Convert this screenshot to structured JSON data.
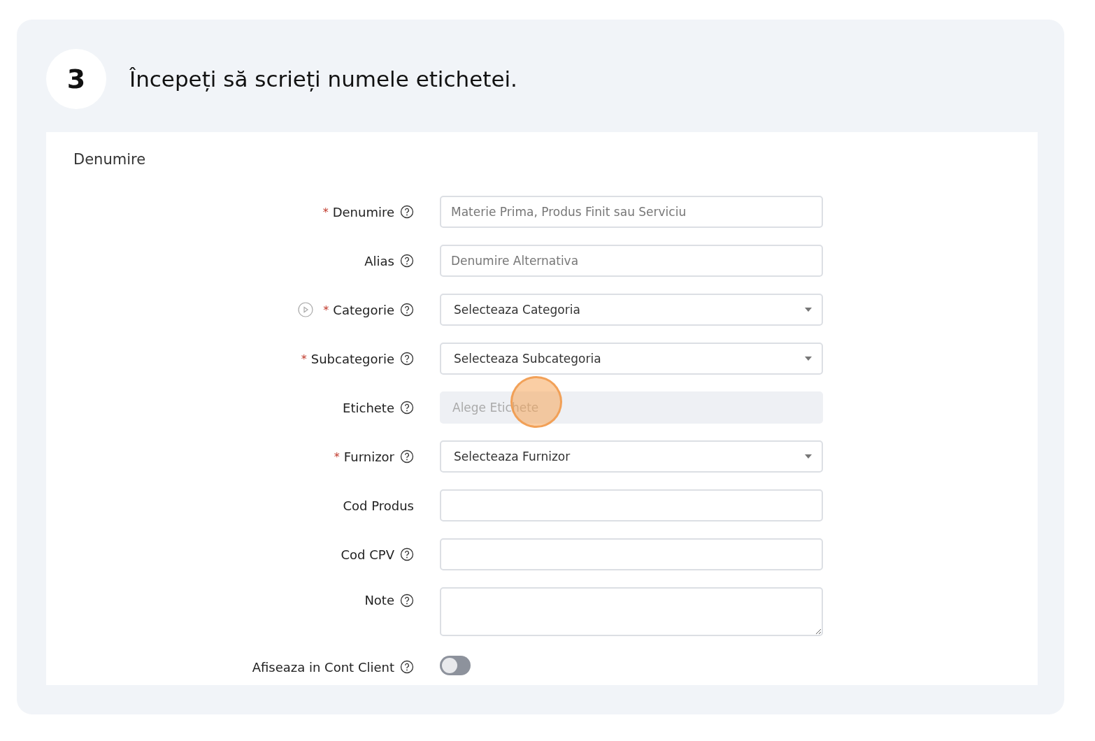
{
  "step": {
    "number": "3",
    "instruction": "Începeți să scrieți numele etichetei."
  },
  "section": {
    "title": "Denumire"
  },
  "fields": [
    {
      "kind": "text",
      "label": "Denumire",
      "required_mark": "*",
      "help": true,
      "placeholder": "Materie Prima, Produs Finit sau Serviciu"
    },
    {
      "kind": "text",
      "label": "Alias",
      "help": true,
      "placeholder": "Denumire Alternativa"
    },
    {
      "kind": "select",
      "label": "Categorie",
      "required_mark": "*",
      "help": true,
      "play": true,
      "value": "Selecteaza Categoria"
    },
    {
      "kind": "select",
      "label": "Subcategorie",
      "required_mark": "*",
      "help": true,
      "value": "Selecteaza Subcategoria"
    },
    {
      "kind": "tags",
      "label": "Etichete",
      "help": true,
      "disabled": true,
      "highlighted": true,
      "placeholder": "Alege Etichete"
    },
    {
      "kind": "select",
      "label": "Furnizor",
      "required_mark": "*",
      "help": true,
      "value": "Selecteaza Furnizor"
    },
    {
      "kind": "text",
      "label": "Cod Produs",
      "help": false
    },
    {
      "kind": "text",
      "label": "Cod CPV",
      "help": true
    },
    {
      "kind": "textarea",
      "label": "Note",
      "help": true
    },
    {
      "kind": "toggle",
      "label": "Afiseaza in Cont Client",
      "help": true,
      "on": false
    }
  ]
}
